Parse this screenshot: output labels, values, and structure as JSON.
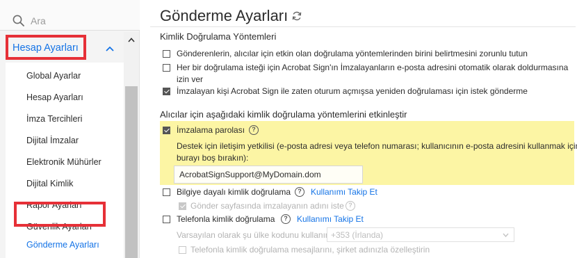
{
  "search": {
    "placeholder": "Ara"
  },
  "sidebar": {
    "group_label": "Hesap Ayarları",
    "items": [
      {
        "label": "Global Ayarlar"
      },
      {
        "label": "Hesap Ayarları"
      },
      {
        "label": "İmza Tercihleri"
      },
      {
        "label": "Dijital İmzalar"
      },
      {
        "label": "Elektronik Mühürler"
      },
      {
        "label": "Dijital Kimlik"
      },
      {
        "label": "Rapor Ayarları"
      },
      {
        "label": "Güvenlik Ayarları"
      },
      {
        "label": "Gönderme Ayarları"
      }
    ],
    "active_item": "Gönderme Ayarları"
  },
  "main": {
    "title": "Gönderme Ayarları",
    "identity_section": {
      "title": "Kimlik Doğrulama Yöntemleri",
      "options": [
        {
          "label": "Gönderenlerin, alıcılar için etkin olan doğrulama yöntemlerinden birini belirtmesini zorunlu tutun",
          "checked": false
        },
        {
          "label_line1": "Her bir doğrulama isteği için Acrobat Sign'ın İmzalayanların e-posta adresini otomatik olarak doldurmasına",
          "label_line2": "izin ver",
          "checked": false
        },
        {
          "label": "İmzalayan kişi Acrobat Sign ile zaten oturum açmışsa yeniden doğrulaması için istek gönderme",
          "checked": true
        }
      ]
    },
    "recipient_section": {
      "title": "Alıcılar için aşağıdaki kimlik doğrulama yöntemlerini etkinleştir",
      "password": {
        "label": "İmzalama parolası",
        "checked": true,
        "help_line1": "Destek için iletişim yetkilisi (e-posta adresi veya telefon numarası; kullanıcının e-posta adresini kullanmak için",
        "help_line2": "burayı boş bırakın):",
        "support_value": "AcrobatSignSupport@MyDomain.dom"
      },
      "kba": {
        "label": "Bilgiye dayalı kimlik doğrulama",
        "checked": false,
        "link": "Kullanımı Takip Et",
        "sub_label": "Gönder sayfasında imzalayanın adını iste",
        "sub_checked": true
      },
      "phone": {
        "label": "Telefonla kimlik doğrulama",
        "checked": false,
        "link": "Kullanımı Takip Et",
        "country_label": "Varsayılan olarak şu ülke kodunu kullanın:",
        "country_value": "+353 (İrlanda)",
        "sms_label": "Telefonla kimlik doğrulama mesajlarını, şirket adınızla özelleştirin",
        "sms_checked": false
      }
    }
  },
  "colors": {
    "accent": "#1473e6",
    "highlight": "#fcf5a4",
    "annotation_box": "#e63037"
  },
  "icons": {
    "search": "search-icon",
    "refresh": "refresh-icon",
    "help": "question-circle-icon",
    "chevron_up": "chevron-up-icon",
    "chevron_down": "chevron-down-icon"
  }
}
